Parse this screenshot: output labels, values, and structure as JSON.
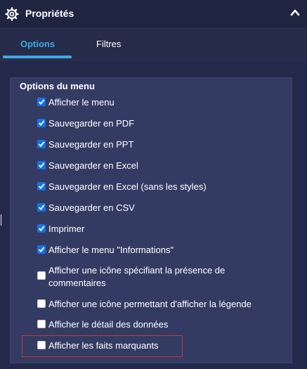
{
  "header": {
    "title": "Propriétés",
    "icon": "gear-icon",
    "collapse_icon": "chevron-up-icon"
  },
  "tabs": [
    {
      "label": "Options",
      "active": true
    },
    {
      "label": "Filtres",
      "active": false
    }
  ],
  "section": {
    "title": "Options du menu"
  },
  "options": [
    {
      "label": "Afficher le menu",
      "checked": true
    },
    {
      "label": "Sauvegarder en PDF",
      "checked": true
    },
    {
      "label": "Sauvegarder en PPT",
      "checked": true
    },
    {
      "label": "Sauvegarder en Excel",
      "checked": true
    },
    {
      "label": "Sauvegarder en Excel (sans les styles)",
      "checked": true
    },
    {
      "label": "Sauvegarder en CSV",
      "checked": true
    },
    {
      "label": "Imprimer",
      "checked": true
    },
    {
      "label": "Afficher le menu \"Informations\"",
      "checked": true
    },
    {
      "label": "Afficher une icône spécifiant la présence de commentaires",
      "checked": false
    },
    {
      "label": "Afficher une icône permettant d'afficher la légende",
      "checked": false
    },
    {
      "label": "Afficher le détail des données",
      "checked": false
    },
    {
      "label": "Afficher les faits marquants",
      "checked": false
    }
  ],
  "colors": {
    "accent": "#3ea8e5",
    "checkbox": "#1473e6",
    "highlight": "#c0393b"
  }
}
